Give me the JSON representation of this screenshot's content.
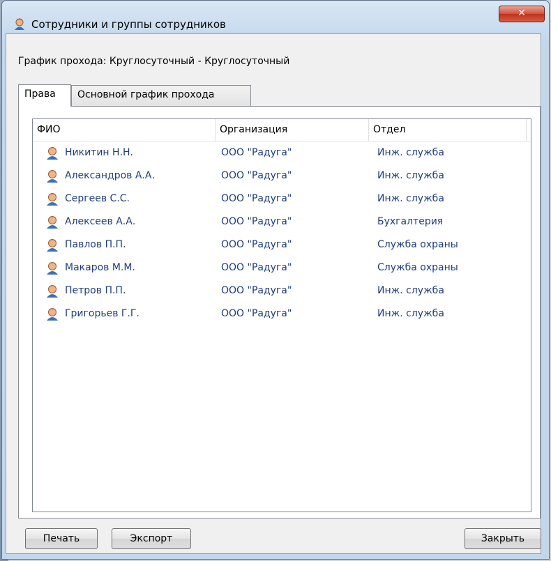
{
  "window": {
    "title": "Сотрудники и группы сотрудников",
    "close_glyph": "✕"
  },
  "schedule_label": "График прохода: Круглосуточный - Круглосуточный",
  "tabs": [
    {
      "label": "Права",
      "active": true
    },
    {
      "label": "Основной график прохода",
      "active": false
    }
  ],
  "grid": {
    "columns": [
      "ФИО",
      "Организация",
      "Отдел"
    ],
    "rows": [
      {
        "name": "Никитин Н.Н.",
        "org": "ООО \"Радуга\"",
        "dept": "Инж. служба"
      },
      {
        "name": "Александров А.А.",
        "org": "ООО \"Радуга\"",
        "dept": "Инж. служба"
      },
      {
        "name": "Сергеев С.С.",
        "org": "ООО \"Радуга\"",
        "dept": "Инж. служба"
      },
      {
        "name": "Алексеев А.А.",
        "org": "ООО \"Радуга\"",
        "dept": "Бухгалтерия"
      },
      {
        "name": "Павлов П.П.",
        "org": "ООО \"Радуга\"",
        "dept": "Служба охраны"
      },
      {
        "name": "Макаров М.М.",
        "org": "ООО \"Радуга\"",
        "dept": "Служба охраны"
      },
      {
        "name": "Петров П.П.",
        "org": "ООО \"Радуга\"",
        "dept": "Инж. служба"
      },
      {
        "name": "Григорьев Г.Г.",
        "org": "ООО \"Радуга\"",
        "dept": "Инж. служба"
      }
    ]
  },
  "buttons": {
    "print": "Печать",
    "export": "Экспорт",
    "close": "Закрыть"
  },
  "colors": {
    "row_text": "#1f3d7a",
    "close_button": "#c0301c"
  }
}
